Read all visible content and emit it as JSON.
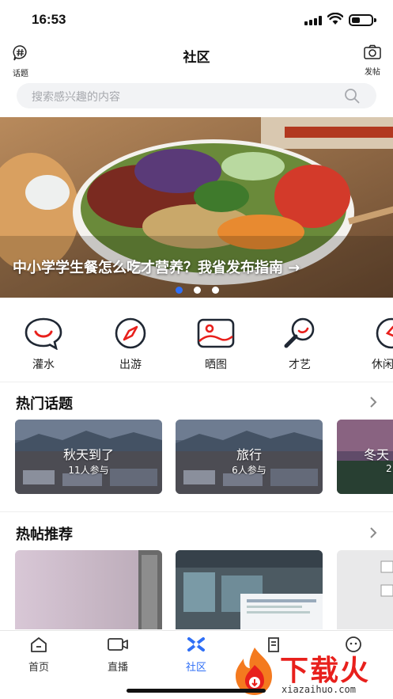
{
  "status_bar": {
    "time": "16:53"
  },
  "header": {
    "title": "社区",
    "topic_label": "话题",
    "post_label": "发帖"
  },
  "search": {
    "placeholder": "搜索感兴趣的内容"
  },
  "banner": {
    "caption": "中小学学生餐怎么吃才营养？我省发布指南 →",
    "page_count": 3,
    "active_index": 0
  },
  "categories": [
    {
      "label": "灌水",
      "icon": "chat-bubble-smile-icon"
    },
    {
      "label": "出游",
      "icon": "compass-icon"
    },
    {
      "label": "晒图",
      "icon": "picture-icon"
    },
    {
      "label": "才艺",
      "icon": "magnifier-icon"
    },
    {
      "label": "休闲",
      "icon": "leisure-icon"
    }
  ],
  "hot_topics": {
    "title": "热门话题",
    "items": [
      {
        "name": "秋天到了",
        "count": "11人参与"
      },
      {
        "name": "旅行",
        "count": "6人参与"
      },
      {
        "name": "冬天",
        "count": "2"
      }
    ]
  },
  "hot_posts": {
    "title": "热帖推荐"
  },
  "tabbar": {
    "active": "社区",
    "items": [
      {
        "label": "首页",
        "icon": "home-icon"
      },
      {
        "label": "直播",
        "icon": "video-camera-icon"
      },
      {
        "label": "社区",
        "icon": "community-icon"
      },
      {
        "label": "",
        "icon": "news-icon"
      },
      {
        "label": "",
        "icon": "profile-icon"
      }
    ]
  },
  "watermark": {
    "text": "下载火",
    "url": "xiazaihuo.com"
  },
  "colors": {
    "accent": "#2f6ff6",
    "icon_red": "#e8201c",
    "icon_dark": "#1f2733"
  }
}
